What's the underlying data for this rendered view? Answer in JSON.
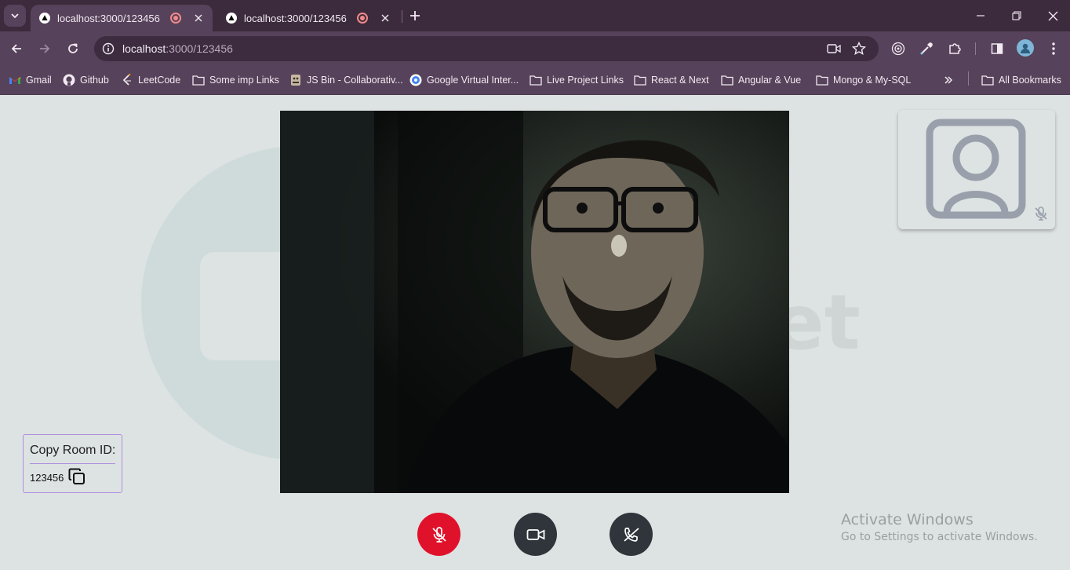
{
  "browser": {
    "tabs": [
      {
        "title": "localhost:3000/123456",
        "active": true
      },
      {
        "title": "localhost:3000/123456",
        "active": false
      }
    ],
    "address": {
      "host": "localhost",
      "rest": ":3000/123456"
    },
    "bookmarks": [
      {
        "label": "Gmail",
        "icon": "gmail-icon"
      },
      {
        "label": "Github",
        "icon": "github-icon"
      },
      {
        "label": "LeetCode",
        "icon": "leetcode-icon"
      },
      {
        "label": "Some imp Links",
        "icon": "folder-icon"
      },
      {
        "label": "JS Bin - Collaborativ...",
        "icon": "jsbin-icon"
      },
      {
        "label": "Google Virtual Inter...",
        "icon": "google-icon"
      },
      {
        "label": "Live Project Links",
        "icon": "folder-icon"
      },
      {
        "label": "React & Next",
        "icon": "folder-icon"
      },
      {
        "label": "Angular & Vue",
        "icon": "folder-icon"
      },
      {
        "label": "Mongo & My-SQL",
        "icon": "folder-icon"
      }
    ],
    "all_bookmarks": "All Bookmarks"
  },
  "meeting": {
    "bg_logo_text": "Meet",
    "room": {
      "label": "Copy Room ID:",
      "id": "123456"
    },
    "controls": {
      "mic": {
        "state": "muted",
        "color": "#e0112b",
        "icon": "mic-off-icon"
      },
      "camera": {
        "state": "on",
        "color": "#2f353b",
        "icon": "video-camera-icon"
      },
      "call": {
        "icon": "phone-hangup-icon",
        "color": "#2f353b"
      }
    },
    "self_view": {
      "icon": "user-placeholder-icon",
      "mic_state": "muted"
    }
  },
  "os": {
    "watermark_title": "Activate Windows",
    "watermark_sub": "Go to Settings to activate Windows."
  },
  "colors": {
    "tabstrip": "#3c2b3c",
    "toolbar": "#56425a",
    "page_bg": "#dde2e2",
    "accent_border": "#b08fe0"
  }
}
